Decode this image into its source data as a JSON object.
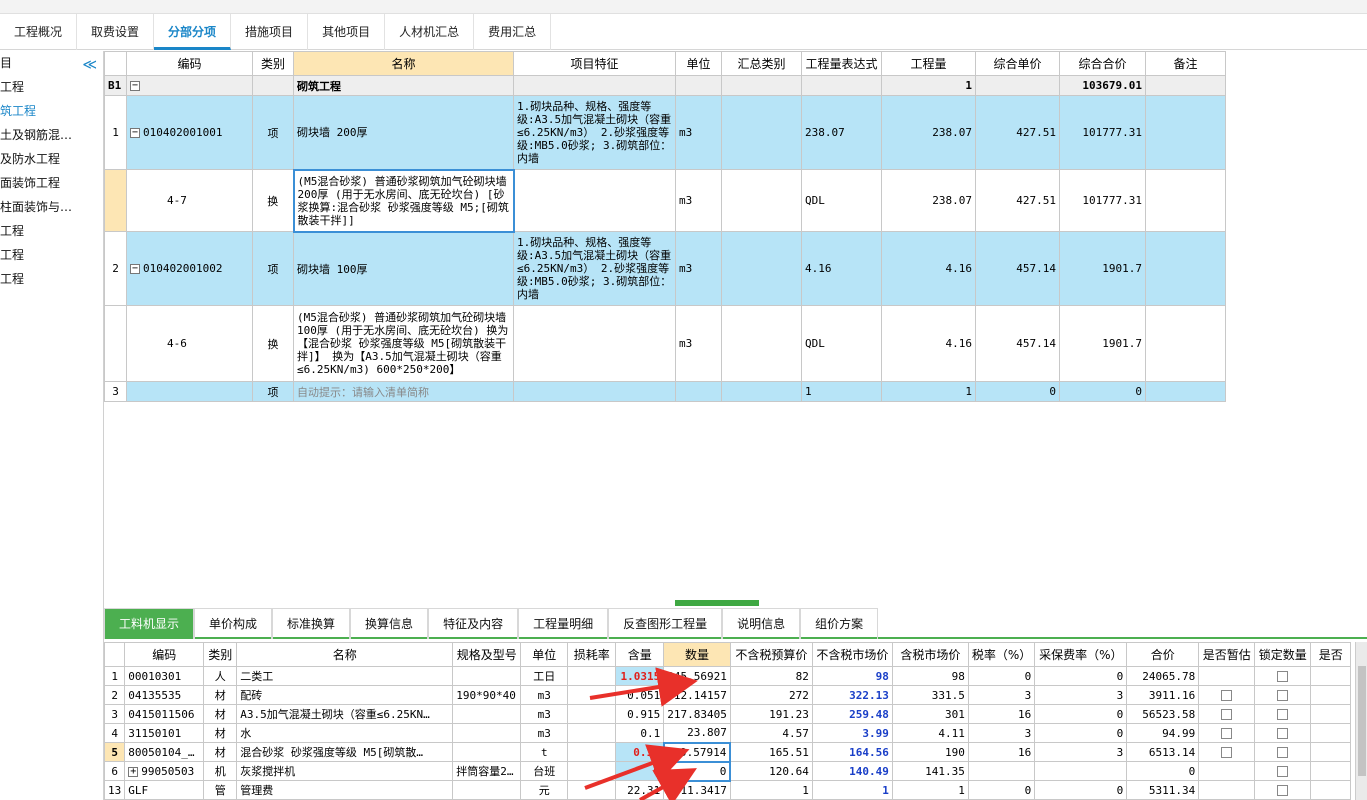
{
  "tabs": [
    "工程概况",
    "取费设置",
    "分部分项",
    "措施项目",
    "其他项目",
    "人材机汇总",
    "费用汇总"
  ],
  "active_tab": "分部分项",
  "sidebar": {
    "items": [
      "目",
      "工程",
      "筑工程",
      "土及钢筋混…",
      "及防水工程",
      "面装饰工程",
      "柱面装饰与…",
      "工程",
      "工程",
      "工程"
    ],
    "collapse": "≪"
  },
  "grid": {
    "headers": [
      "编码",
      "类别",
      "名称",
      "项目特征",
      "单位",
      "汇总类别",
      "工程量表达式",
      "工程量",
      "综合单价",
      "综合合价",
      "备注"
    ],
    "section": {
      "id": "B1",
      "name": "砌筑工程",
      "qty": "1",
      "total": "103679.01"
    },
    "rows": [
      {
        "rn": "1",
        "code": "010402001001",
        "type": "项",
        "name": "砌块墙 200厚",
        "feature": "1.砌块品种、规格、强度等级:A3.5加气混凝土砌块（容重≤6.25KN/m3）\n2.砂浆强度等级:MB5.0砂浆;\n3.砌筑部位：内墙",
        "unit": "m3",
        "expr": "238.07",
        "qty": "238.07",
        "price": "427.51",
        "total": "101777.31"
      },
      {
        "rn": "",
        "code": "4-7",
        "type": "换",
        "name": "(M5混合砂浆) 普通砂浆砌筑加气砼砌块墙 200厚 (用于无水房间、底无砼坎台) [砂浆换算:混合砂浆 砂浆强度等级 M5;[砌筑散装干拌]]",
        "feature": "",
        "unit": "m3",
        "expr": "QDL",
        "qty": "238.07",
        "price": "427.51",
        "total": "101777.31"
      },
      {
        "rn": "2",
        "code": "010402001002",
        "type": "项",
        "name": "砌块墙 100厚",
        "feature": "1.砌块品种、规格、强度等级:A3.5加气混凝土砌块（容重≤6.25KN/m3）\n2.砂浆强度等级:MB5.0砂浆;\n3.砌筑部位：内墙",
        "unit": "m3",
        "expr": "4.16",
        "qty": "4.16",
        "price": "457.14",
        "total": "1901.7"
      },
      {
        "rn": "",
        "code": "4-6",
        "type": "换",
        "name": "(M5混合砂浆) 普通砂浆砌筑加气砼砌块墙 100厚 (用于无水房间、底无砼坎台) 换为【混合砂浆 砂浆强度等级 M5[砌筑散装干拌]】 换为【A3.5加气混凝土砌块（容重≤6.25KN/m3) 600*250*200】",
        "feature": "",
        "unit": "m3",
        "expr": "QDL",
        "qty": "4.16",
        "price": "457.14",
        "total": "1901.7"
      },
      {
        "rn": "3",
        "code": "",
        "type": "项",
        "name": "自动提示：请输入清单简称",
        "feature": "",
        "unit": "",
        "expr": "1",
        "qty": "1",
        "price": "0",
        "total": "0"
      }
    ]
  },
  "bottom_tabs": [
    "工料机显示",
    "单价构成",
    "标准换算",
    "换算信息",
    "特征及内容",
    "工程量明细",
    "反查图形工程量",
    "说明信息",
    "组价方案"
  ],
  "bottom_active": "工料机显示",
  "bottom_grid": {
    "headers": [
      "编码",
      "类别",
      "名称",
      "规格及型号",
      "单位",
      "损耗率",
      "含量",
      "数量",
      "不含税预算价",
      "不含税市场价",
      "含税市场价",
      "税率（%）",
      "采保费率（%）",
      "合价",
      "是否暂估",
      "锁定数量",
      "是否"
    ],
    "rows": [
      {
        "rn": "1",
        "code": "00010301",
        "type": "人",
        "name": "二类工",
        "spec": "",
        "unit": "工日",
        "loss": "",
        "content": "1.0315",
        "qty": "245.56921",
        "budget": "82",
        "market": "98",
        "tax_market": "98",
        "tax": "0",
        "fee": "0",
        "total": "24065.78",
        "est": false,
        "lock": true
      },
      {
        "rn": "2",
        "code": "04135535",
        "type": "材",
        "name": "配砖",
        "spec": "190*90*40",
        "unit": "m3",
        "loss": "",
        "content": "0.051",
        "qty": "12.14157",
        "budget": "272",
        "market": "322.13",
        "tax_market": "331.5",
        "tax": "3",
        "fee": "3",
        "total": "3911.16",
        "est": true,
        "lock": true
      },
      {
        "rn": "3",
        "code": "0415011506",
        "type": "材",
        "name": "A3.5加气混凝土砌块（容重≤6.25KN…",
        "spec": "",
        "unit": "m3",
        "loss": "",
        "content": "0.915",
        "qty": "217.83405",
        "budget": "191.23",
        "market": "259.48",
        "tax_market": "301",
        "tax": "16",
        "fee": "0",
        "total": "56523.58",
        "est": true,
        "lock": true
      },
      {
        "rn": "4",
        "code": "31150101",
        "type": "材",
        "name": "水",
        "spec": "",
        "unit": "m3",
        "loss": "",
        "content": "0.1",
        "qty": "23.807",
        "budget": "4.57",
        "market": "3.99",
        "tax_market": "4.11",
        "tax": "3",
        "fee": "0",
        "total": "94.99",
        "est": true,
        "lock": true
      },
      {
        "rn": "5",
        "code": "80050104_…",
        "type": "材",
        "name": "混合砂浆 砂浆强度等级 M5[砌筑散…",
        "spec": "",
        "unit": "t",
        "loss": "",
        "content": "0.16",
        "qty": "39.57914",
        "budget": "165.51",
        "market": "164.56",
        "tax_market": "190",
        "tax": "16",
        "fee": "3",
        "total": "6513.14",
        "est": true,
        "lock": true
      },
      {
        "rn": "6",
        "code": "99050503",
        "type": "机",
        "name": "灰浆搅拌机",
        "spec": "拌筒容量2…",
        "unit": "台班",
        "loss": "",
        "content": "0",
        "qty": "0",
        "budget": "120.64",
        "market": "140.49",
        "tax_market": "141.35",
        "tax": "",
        "fee": "",
        "total": "0",
        "est": false,
        "lock": true
      },
      {
        "rn": "13",
        "code": "GLF",
        "type": "管",
        "name": "管理费",
        "spec": "",
        "unit": "元",
        "loss": "",
        "content": "22.31",
        "qty": "5311.3417",
        "budget": "1",
        "market": "1",
        "tax_market": "1",
        "tax": "0",
        "fee": "0",
        "total": "5311.34",
        "est": false,
        "lock": true
      }
    ]
  },
  "colors": {
    "accent": "#1a86c8",
    "row_blue": "#b7e4f7",
    "green": "#4caf50",
    "arrow": "#e8302a"
  }
}
